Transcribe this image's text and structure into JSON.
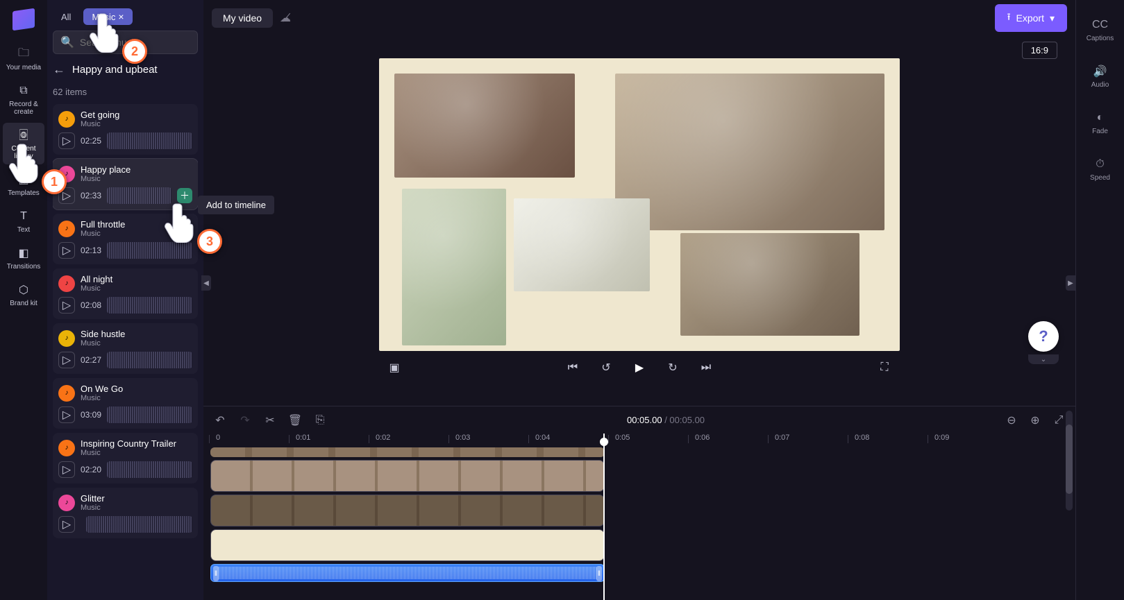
{
  "nav": {
    "media": "Your media",
    "record": "Record & create",
    "library": "Content library",
    "templates": "Templates",
    "text": "Text",
    "transitions": "Transitions",
    "brand": "Brand kit"
  },
  "filters": {
    "all": "All",
    "music": "Music"
  },
  "search": {
    "placeholder": "Search music"
  },
  "breadcrumb": {
    "title": "Happy and upbeat"
  },
  "item_count": "62 items",
  "tooltip": {
    "add": "Add to timeline"
  },
  "tracks": [
    {
      "title": "Get going",
      "sub": "Music",
      "duration": "02:25",
      "color": "#f59e0b"
    },
    {
      "title": "Happy place",
      "sub": "Music",
      "duration": "02:33",
      "color": "#ec4899",
      "selected": true
    },
    {
      "title": "Full throttle",
      "sub": "Music",
      "duration": "02:13",
      "color": "#f97316"
    },
    {
      "title": "All night",
      "sub": "Music",
      "duration": "02:08",
      "color": "#ef4444"
    },
    {
      "title": "Side hustle",
      "sub": "Music",
      "duration": "02:27",
      "color": "#eab308"
    },
    {
      "title": "On We Go",
      "sub": "Music",
      "duration": "03:09",
      "color": "#f97316"
    },
    {
      "title": "Inspiring Country Trailer",
      "sub": "Music",
      "duration": "02:20",
      "color": "#f97316"
    },
    {
      "title": "Glitter",
      "sub": "Music",
      "duration": "",
      "color": "#ec4899"
    }
  ],
  "topbar": {
    "title": "My video",
    "export": "Export"
  },
  "aspect": "16:9",
  "timecode": {
    "current": "00:05.00",
    "sep": " / ",
    "total": "00:05.00"
  },
  "ruler": [
    "0",
    "0:01",
    "0:02",
    "0:03",
    "0:04",
    "0:05",
    "0:06",
    "0:07",
    "0:08",
    "0:09"
  ],
  "right": {
    "captions": "Captions",
    "audio": "Audio",
    "fade": "Fade",
    "speed": "Speed"
  },
  "pointers": {
    "p1": "1",
    "p2": "2",
    "p3": "3"
  },
  "help": "?"
}
